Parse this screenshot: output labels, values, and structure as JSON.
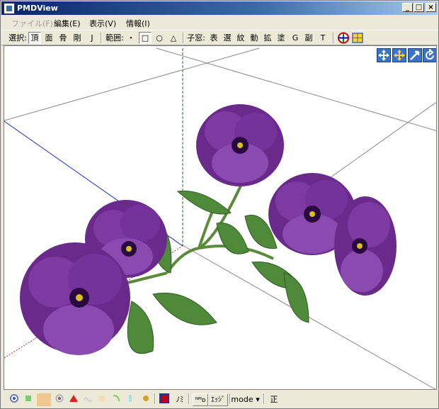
{
  "window": {
    "title": "PMDView",
    "min": "_",
    "max": "□",
    "close": "×"
  },
  "menu": [
    {
      "label": "ファイル(F)",
      "disabled": true
    },
    {
      "label": "編集(E)"
    },
    {
      "label": "表示(V)"
    },
    {
      "label": "情報(I)"
    }
  ],
  "toolbar": {
    "select_label": "選択:",
    "select_modes": [
      "頂",
      "面",
      "骨",
      "剛",
      "J"
    ],
    "range_label": "範囲:",
    "range_shapes": [
      "・",
      "□",
      "○",
      "△"
    ],
    "child_label": "子窓:",
    "child_windows": [
      "表",
      "選",
      "紋",
      "動",
      "拡",
      "塗",
      "G",
      "副",
      "T"
    ]
  },
  "viewport": {
    "nav_icons": [
      "move-icon",
      "pan-icon",
      "zoom-icon",
      "rotate-icon"
    ]
  },
  "statusbar": {
    "mirror_label": "ﾉﾐ",
    "normals_label": "ᴺᴹᴅ",
    "edge_label": "ｴｯｼﾞ",
    "mode_label": "mode",
    "mode_arrow": "▾",
    "ortho_label": "正"
  },
  "colors": {
    "title_start": "#0a246a",
    "title_end": "#a6caf0",
    "petal": "#6a2a8c",
    "leaf": "#4f8a3a"
  }
}
